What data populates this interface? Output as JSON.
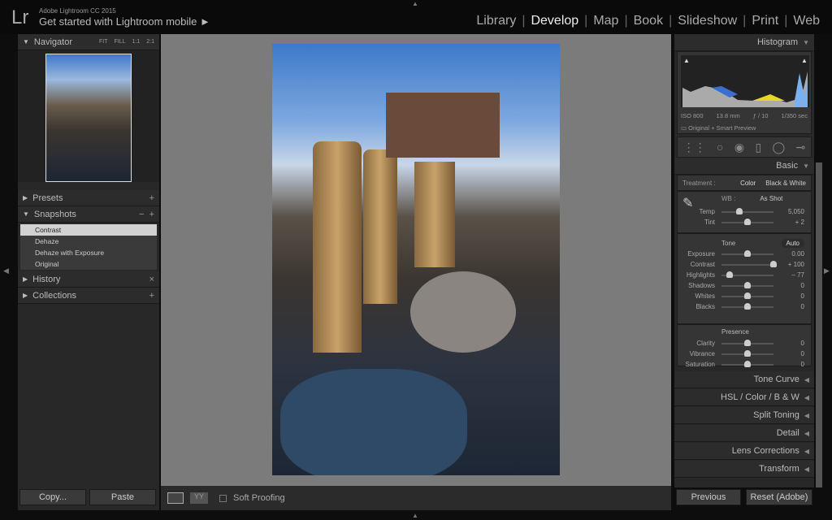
{
  "app": {
    "logo": "Lr",
    "product": "Adobe Lightroom CC 2015",
    "promo": "Get started with Lightroom mobile ►"
  },
  "modules": [
    "Library",
    "Develop",
    "Map",
    "Book",
    "Slideshow",
    "Print",
    "Web"
  ],
  "active_module": "Develop",
  "left": {
    "navigator": {
      "title": "Navigator",
      "zoom": [
        "FIT",
        "FILL",
        "1:1",
        "2:1"
      ]
    },
    "presets": "Presets",
    "snapshots": "Snapshots",
    "snapshot_items": [
      "Contrast",
      "Dehaze",
      "Dehaze with Exposure",
      "Original"
    ],
    "selected_snapshot": "Contrast",
    "history": "History",
    "collections": "Collections",
    "copy": "Copy...",
    "paste": "Paste"
  },
  "toolbar": {
    "soft_proofing": "Soft Proofing"
  },
  "right": {
    "histogram": {
      "title": "Histogram",
      "iso": "ISO 800",
      "focal": "13.8 mm",
      "aperture": "ƒ / 10",
      "shutter": "1/350 sec",
      "preview": "Original + Smart Preview"
    },
    "basic": {
      "title": "Basic",
      "treatment_label": "Treatment :",
      "color": "Color",
      "bw": "Black & White",
      "wb_label": "WB :",
      "wb": "As Shot",
      "wb_sliders": [
        {
          "label": "Temp",
          "value": "5,050",
          "pos": 0.35
        },
        {
          "label": "Tint",
          "value": "+ 2",
          "pos": 0.5
        }
      ],
      "tone": "Tone",
      "auto": "Auto",
      "tone_sliders": [
        {
          "label": "Exposure",
          "value": "0.00",
          "pos": 0.5
        },
        {
          "label": "Contrast",
          "value": "+ 100",
          "pos": 1.0
        },
        {
          "label": "Highlights",
          "value": "– 77",
          "pos": 0.15
        },
        {
          "label": "Shadows",
          "value": "0",
          "pos": 0.5
        },
        {
          "label": "Whites",
          "value": "0",
          "pos": 0.5
        },
        {
          "label": "Blacks",
          "value": "0",
          "pos": 0.5
        }
      ],
      "presence": "Presence",
      "presence_sliders": [
        {
          "label": "Clarity",
          "value": "0",
          "pos": 0.5
        },
        {
          "label": "Vibrance",
          "value": "0",
          "pos": 0.5
        },
        {
          "label": "Saturation",
          "value": "0",
          "pos": 0.5
        }
      ]
    },
    "panels": [
      "Tone Curve",
      "HSL / Color / B & W",
      "Split Toning",
      "Detail",
      "Lens Corrections",
      "Transform"
    ],
    "previous": "Previous",
    "reset": "Reset (Adobe)"
  }
}
